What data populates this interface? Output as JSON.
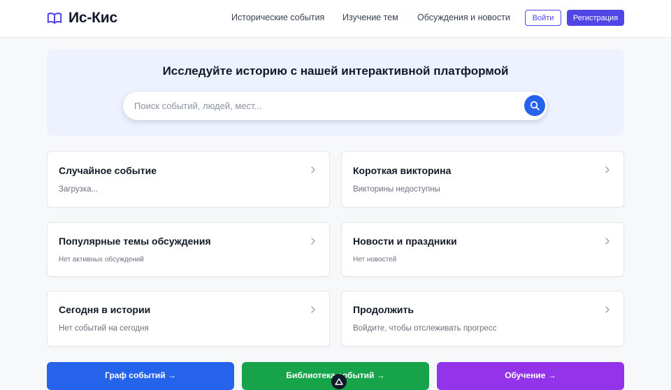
{
  "brand": {
    "name": "Ис-Кис",
    "icon": "open-book-icon",
    "color": "#4f46e5"
  },
  "nav": {
    "items": [
      "Исторические события",
      "Изучение тем",
      "Обсуждения и новости"
    ],
    "login_label": "Войти",
    "register_label": "Регистрация"
  },
  "hero": {
    "title": "Исследуйте историю с нашей интерактивной платформой",
    "search_placeholder": "Поиск событий, людей, мест...",
    "search_icon": "search-icon"
  },
  "cards": [
    {
      "title": "Случайное событие",
      "subtitle": "Загрузка..."
    },
    {
      "title": "Короткая викторина",
      "subtitle": "Викторины недоступны"
    },
    {
      "title": "Популярные темы обсуждения",
      "subtitle": "Нет активных обсуждений"
    },
    {
      "title": "Новости и праздники",
      "subtitle": "Нет новостей"
    },
    {
      "title": "Сегодня в истории",
      "subtitle": "Нет событий на сегодня"
    },
    {
      "title": "Продолжить",
      "subtitle": "Войдите, чтобы отслеживать прогресс"
    }
  ],
  "actions": [
    {
      "label": "Граф событий →",
      "color": "#2563eb"
    },
    {
      "label": "Библиотека событий →",
      "color": "#16a34a"
    },
    {
      "label": "Обучение →",
      "color": "#9333ea"
    }
  ],
  "colors": {
    "accent": "#4f46e5",
    "hero_bg": "#eef2ff",
    "search_button": "#2563eb"
  }
}
